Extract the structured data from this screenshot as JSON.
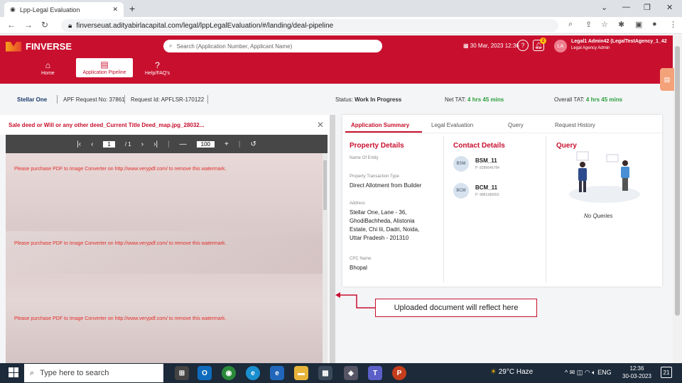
{
  "browser": {
    "tab_title": "Lpp-Legal Evaluation",
    "url": "finverseuat.adityabirlacapital.com/legal/lppLegalEvaluation/#/landing/deal-pipeline"
  },
  "header": {
    "logo_text": "FINVERSE",
    "search_placeholder": "Search (Application Number, Applicant Name)",
    "datetime": "30 Mar, 2023 12:36",
    "notification_count": "2",
    "avatar_initials": "LA",
    "user_name": "Legal1 Admin42 (LegalTestAgency_1_42",
    "user_role": "Legal Agency Admin",
    "nav": [
      {
        "label": "Home",
        "icon": "home-icon"
      },
      {
        "label": "Application Pipeline",
        "icon": "document-icon"
      },
      {
        "label": "Help/FAQ's",
        "icon": "help-icon"
      }
    ]
  },
  "info_strip": {
    "project": "Stellar One",
    "apf_request": "APF Request No: 37861",
    "request_id": "Request Id: APFLSR-170122",
    "status_label": "Status:",
    "status_value": "Work In Progress",
    "net_tat_label": "Net TAT:",
    "net_tat_value": "4 hrs 45 mins",
    "overall_tat_label": "Overall TAT:",
    "overall_tat_value": "4 hrs 45 mins"
  },
  "document": {
    "title": "Sale deed or Will or any other deed_Current Title Deed_map.jpg_28032...",
    "page_current": "1",
    "page_total": "/ 1",
    "zoom": "100",
    "watermark": "Please purchase PDF to Image Converter on http://www.verypdf.com/ to remove this watermark."
  },
  "summary": {
    "tabs": [
      "Application Summary",
      "Legal Evaluation",
      "Query",
      "Request History"
    ],
    "property_details": {
      "heading": "Property Details",
      "entity_label": "Name Of Entity",
      "transaction_label": "Property Transaction Type",
      "transaction_value": "Direct Allotment from Builder",
      "address_label": "Address",
      "address_lines": [
        "Stellar One, Lane - 36,",
        "GhodiBachheda, Alistonia",
        "Estate, Chi Iii, Dadri, Noida,",
        "Uttar Pradesh - 201310"
      ],
      "cpc_label": "CPC Name",
      "cpc_value": "Bhopal"
    },
    "contact_details": {
      "heading": "Contact Details",
      "contacts": [
        {
          "initials": "BSM",
          "name": "BSM_11",
          "phone": "P: 8286646784"
        },
        {
          "initials": "BCM",
          "name": "BCM_11",
          "phone": "P: 9881186653"
        }
      ]
    },
    "query": {
      "heading": "Query",
      "empty_text": "No Queries"
    }
  },
  "annotation": {
    "text": "Uploaded document will reflect here"
  },
  "taskbar": {
    "search_placeholder": "Type here to search",
    "temperature": "29°C",
    "weather": "Haze",
    "lang": "ENG",
    "time": "12:36",
    "date": "30-03-2023",
    "notif_count": "21"
  },
  "colors": {
    "brand": "#c8102e",
    "accent_orange": "#f4a27a",
    "tat_green": "#2e9e3e"
  }
}
